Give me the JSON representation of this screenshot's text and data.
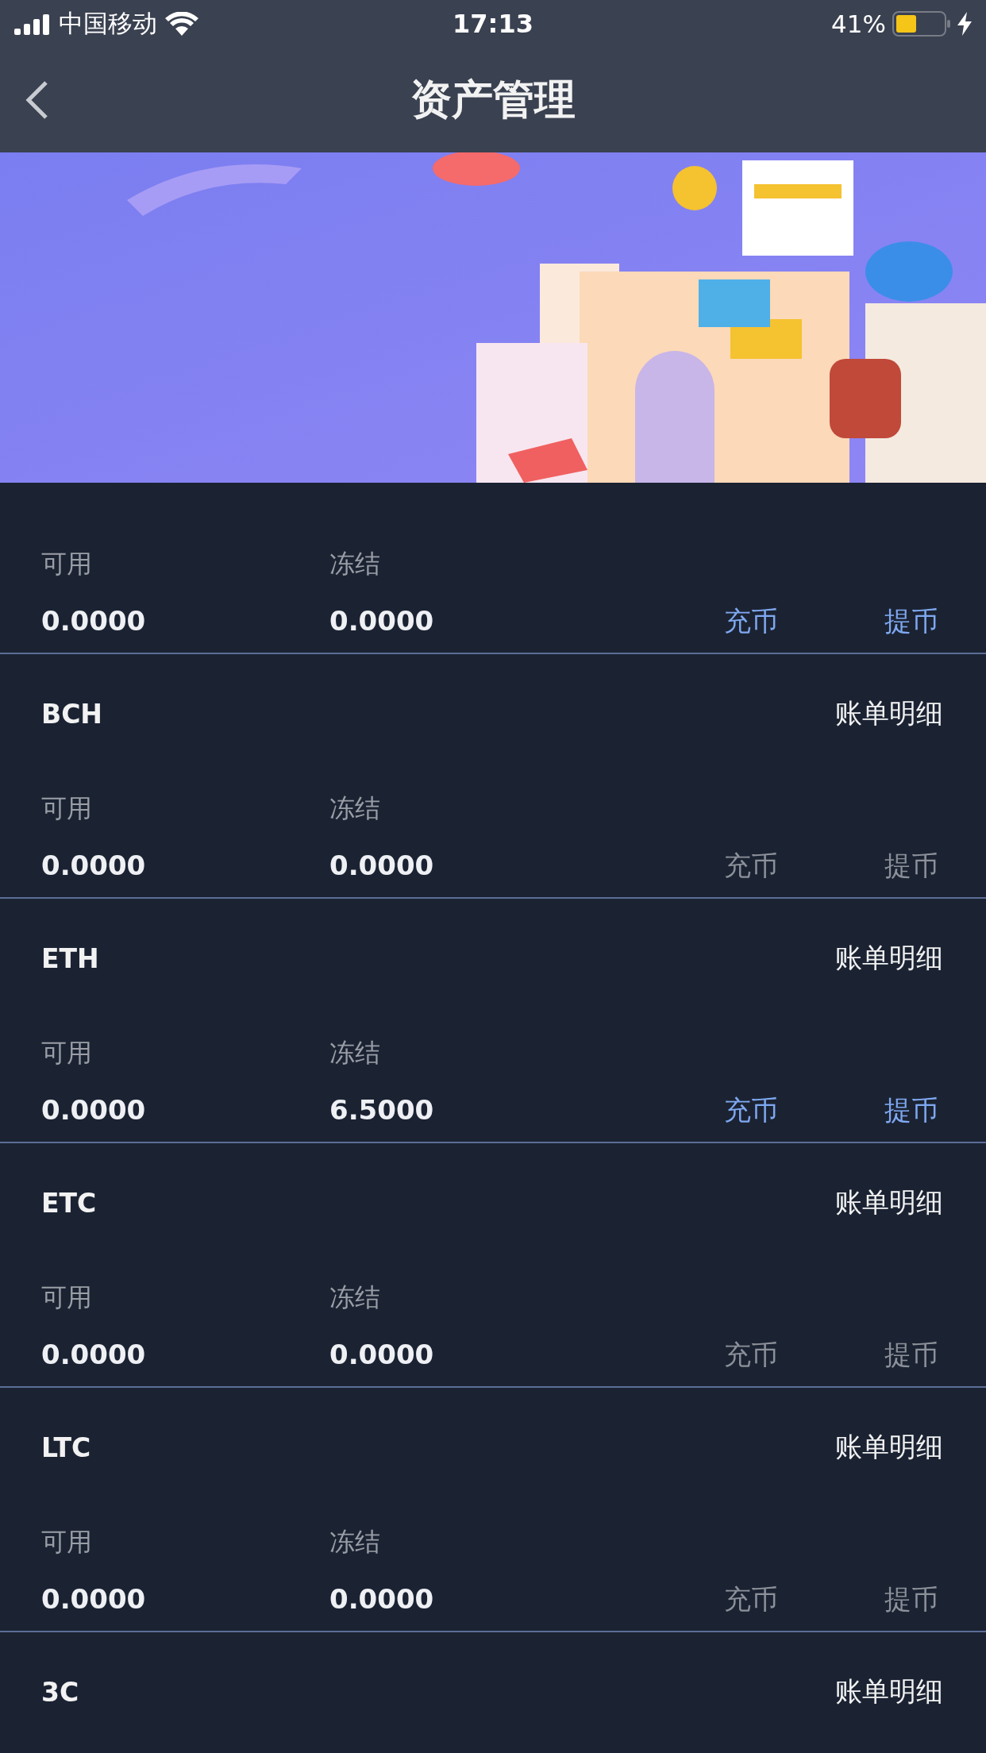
{
  "status_bar": {
    "carrier": "中国移动",
    "time": "17:13",
    "battery": "41%"
  },
  "nav": {
    "title": "资产管理"
  },
  "assets": [
    {
      "available_label": "可用",
      "frozen_label": "冻结",
      "available": "0.0000",
      "frozen": "0.0000",
      "deposit": "充币",
      "withdraw": "提币",
      "enabled": true
    },
    {
      "name": "BCH",
      "bill": "账单明细",
      "available_label": "可用",
      "frozen_label": "冻结",
      "available": "0.0000",
      "frozen": "0.0000",
      "deposit": "充币",
      "withdraw": "提币",
      "enabled": false
    },
    {
      "name": "ETH",
      "bill": "账单明细",
      "available_label": "可用",
      "frozen_label": "冻结",
      "available": "0.0000",
      "frozen": "6.5000",
      "deposit": "充币",
      "withdraw": "提币",
      "enabled": true
    },
    {
      "name": "ETC",
      "bill": "账单明细",
      "available_label": "可用",
      "frozen_label": "冻结",
      "available": "0.0000",
      "frozen": "0.0000",
      "deposit": "充币",
      "withdraw": "提币",
      "enabled": false
    },
    {
      "name": "LTC",
      "bill": "账单明细",
      "available_label": "可用",
      "frozen_label": "冻结",
      "available": "0.0000",
      "frozen": "0.0000",
      "deposit": "充币",
      "withdraw": "提币",
      "enabled": false
    },
    {
      "name": "3C",
      "bill": "账单明细"
    }
  ]
}
